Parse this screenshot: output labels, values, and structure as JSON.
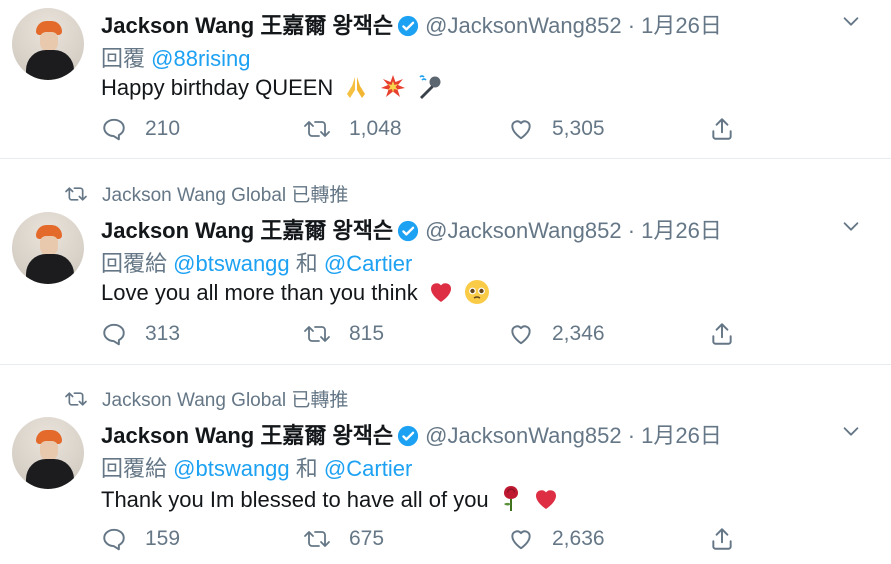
{
  "tweets": [
    {
      "retweeted_by": null,
      "display_name": "Jackson Wang 王嘉爾 왕잭슨",
      "handle": "@JacksonWang852",
      "date": "1月26日",
      "reply_prefix": "回覆",
      "reply_to_1": "@88rising",
      "reply_joiner": "",
      "reply_to_2": "",
      "text": "Happy birthday QUEEN",
      "emojis": [
        "folded-hands",
        "collision",
        "microphone"
      ],
      "replies": "210",
      "retweets": "1,048",
      "likes": "5,305"
    },
    {
      "retweeted_by": "Jackson Wang Global 已轉推",
      "display_name": "Jackson Wang 王嘉爾 왕잭슨",
      "handle": "@JacksonWang852",
      "date": "1月26日",
      "reply_prefix": "回覆給",
      "reply_to_1": "@btswangg",
      "reply_joiner": "和",
      "reply_to_2": "@Cartier",
      "text": "Love you all more than you think",
      "emojis": [
        "red-heart",
        "pleading-face"
      ],
      "replies": "313",
      "retweets": "815",
      "likes": "2,346"
    },
    {
      "retweeted_by": "Jackson Wang Global 已轉推",
      "display_name": "Jackson Wang 王嘉爾 왕잭슨",
      "handle": "@JacksonWang852",
      "date": "1月26日",
      "reply_prefix": "回覆給",
      "reply_to_1": "@btswangg",
      "reply_joiner": "和",
      "reply_to_2": "@Cartier",
      "text": "Thank you Im blessed to have all of you",
      "emojis": [
        "rose",
        "red-heart"
      ],
      "replies": "159",
      "retweets": "675",
      "likes": "2,636"
    }
  ],
  "colors": {
    "link": "#1da1f2",
    "muted": "#657786",
    "verified": "#1da1f2",
    "divider": "#e6ecf0"
  }
}
